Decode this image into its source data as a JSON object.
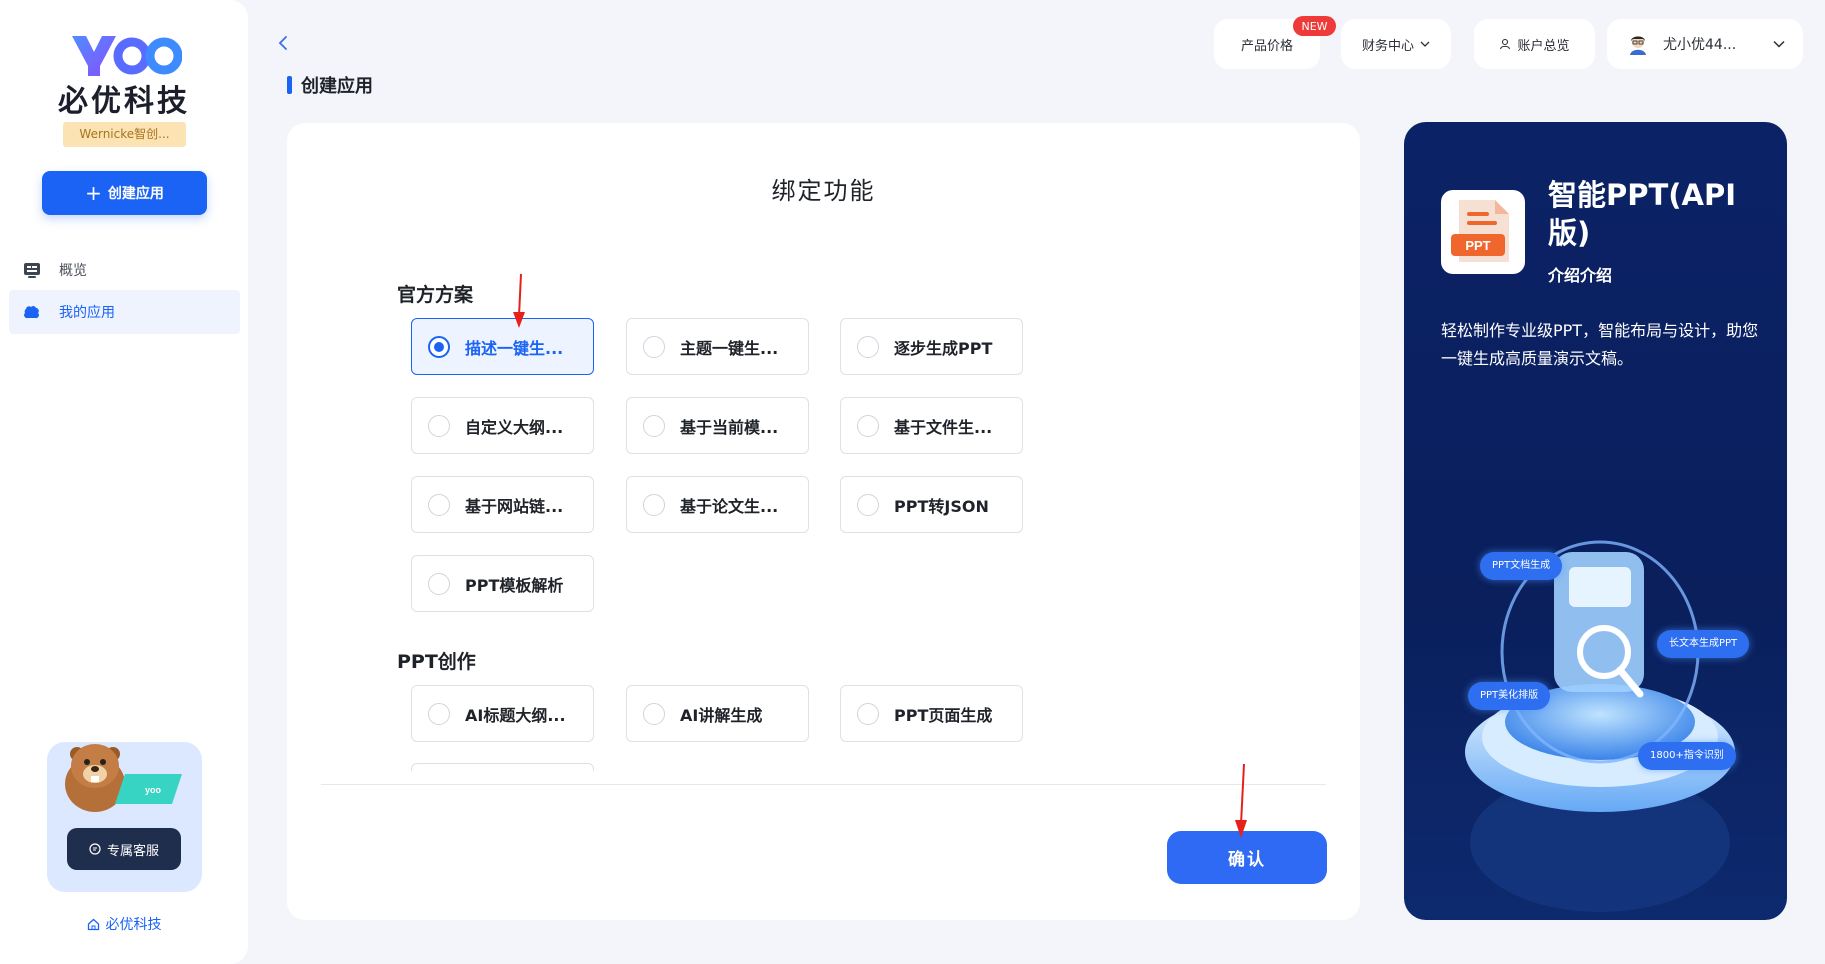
{
  "sidebar": {
    "logo_text": "yoo",
    "brand_name": "必优科技",
    "org_badge": "Wernicke智创...",
    "create_button": "创建应用",
    "nav": [
      {
        "label": "概览",
        "icon": "overview-icon",
        "active": false
      },
      {
        "label": "我的应用",
        "icon": "apps-icon",
        "active": true
      }
    ],
    "service_button": "专属客服",
    "bottom_brand": "必优科技"
  },
  "header": {
    "page_title": "创建应用",
    "pricing": "产品价格",
    "new_badge": "NEW",
    "finance": "财务中心",
    "account": "账户总览",
    "user_name": "尤小优44..."
  },
  "main": {
    "title": "绑定功能",
    "sections": [
      {
        "label": "官方方案",
        "options": [
          {
            "label": "描述一键生...",
            "selected": true
          },
          {
            "label": "主题一键生...",
            "selected": false
          },
          {
            "label": "逐步生成PPT",
            "selected": false
          },
          {
            "label": "自定义大纲...",
            "selected": false
          },
          {
            "label": "基于当前模...",
            "selected": false
          },
          {
            "label": "基于文件生...",
            "selected": false
          },
          {
            "label": "基于网站链...",
            "selected": false
          },
          {
            "label": "基于论文生...",
            "selected": false
          },
          {
            "label": "PPT转JSON",
            "selected": false
          },
          {
            "label": "PPT模板解析",
            "selected": false
          }
        ]
      },
      {
        "label": "PPT创作",
        "options": [
          {
            "label": "AI标题大纲...",
            "selected": false
          },
          {
            "label": "AI讲解生成",
            "selected": false
          },
          {
            "label": "PPT页面生成",
            "selected": false
          }
        ]
      }
    ],
    "confirm_button": "确认"
  },
  "intro": {
    "icon_text": "PPT",
    "app_name": "智能PPT(API版)",
    "subtitle": "介绍介绍",
    "description": "轻松制作专业级PPT，智能布局与设计，助您一键生成高质量演示文稿。",
    "tags": [
      "PPT文档生成",
      "长文本生成PPT",
      "PPT美化排版",
      "1800+指令识别"
    ]
  },
  "colors": {
    "accent": "#1a63f5",
    "panel_bg": "#0b2266",
    "badge_red": "#ee3b39",
    "annotation_red": "#e8201c"
  }
}
